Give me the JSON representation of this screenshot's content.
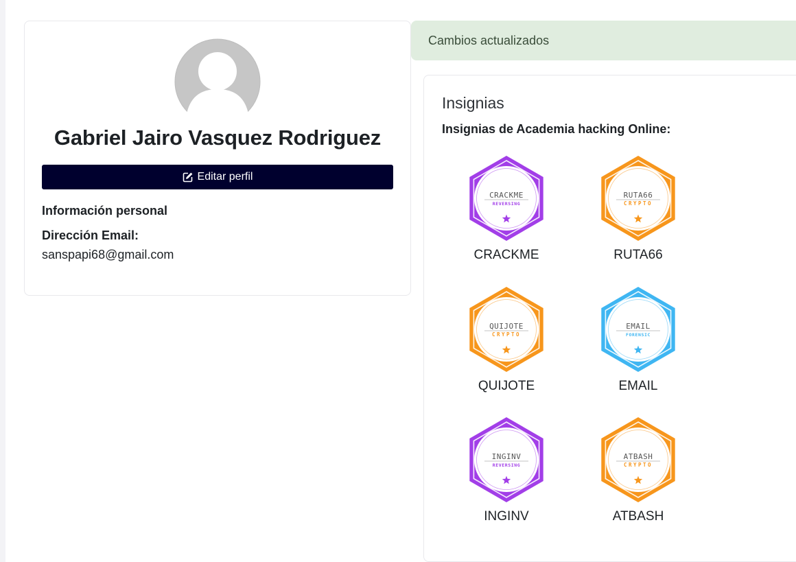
{
  "profile": {
    "full_name": "Gabriel Jairo Vasquez Rodriguez",
    "edit_label": "Editar perfil",
    "section_title": "Información personal",
    "email_label": "Dirección Email:",
    "email_value": "sanspapi68@gmail.com"
  },
  "alert": {
    "message": "Cambios actualizados"
  },
  "badges": {
    "heading": "Insignias",
    "subheading": "Insignias de Academia hacking Online:",
    "items": [
      {
        "name": "CRACKME",
        "logo_text": "CRACKME",
        "category": "REVERSING",
        "color": "#a23ee8"
      },
      {
        "name": "RUTA66",
        "logo_text": "RUTA66",
        "category": "CRYPTO",
        "color": "#f7961c"
      },
      {
        "name": "QUIJOTE",
        "logo_text": "QUIJOTE",
        "category": "CRYPTO",
        "color": "#f7961c"
      },
      {
        "name": "EMAIL",
        "logo_text": "EMAIL",
        "category": "FORENSIC",
        "color": "#3fb6f2"
      },
      {
        "name": "INGINV",
        "logo_text": "INGINV",
        "category": "REVERSING",
        "color": "#a23ee8"
      },
      {
        "name": "ATBASH",
        "logo_text": "ATBASH",
        "category": "CRYPTO",
        "color": "#f7961c"
      }
    ]
  },
  "colors": {
    "button_bg": "#00002e",
    "alert_bg": "#e0eddf",
    "reversing": "#a23ee8",
    "crypto": "#f7961c",
    "forensic": "#3fb6f2"
  },
  "icons": {
    "avatar": "user-avatar-icon",
    "edit": "pencil-square-icon",
    "badge_star": "star-icon"
  }
}
